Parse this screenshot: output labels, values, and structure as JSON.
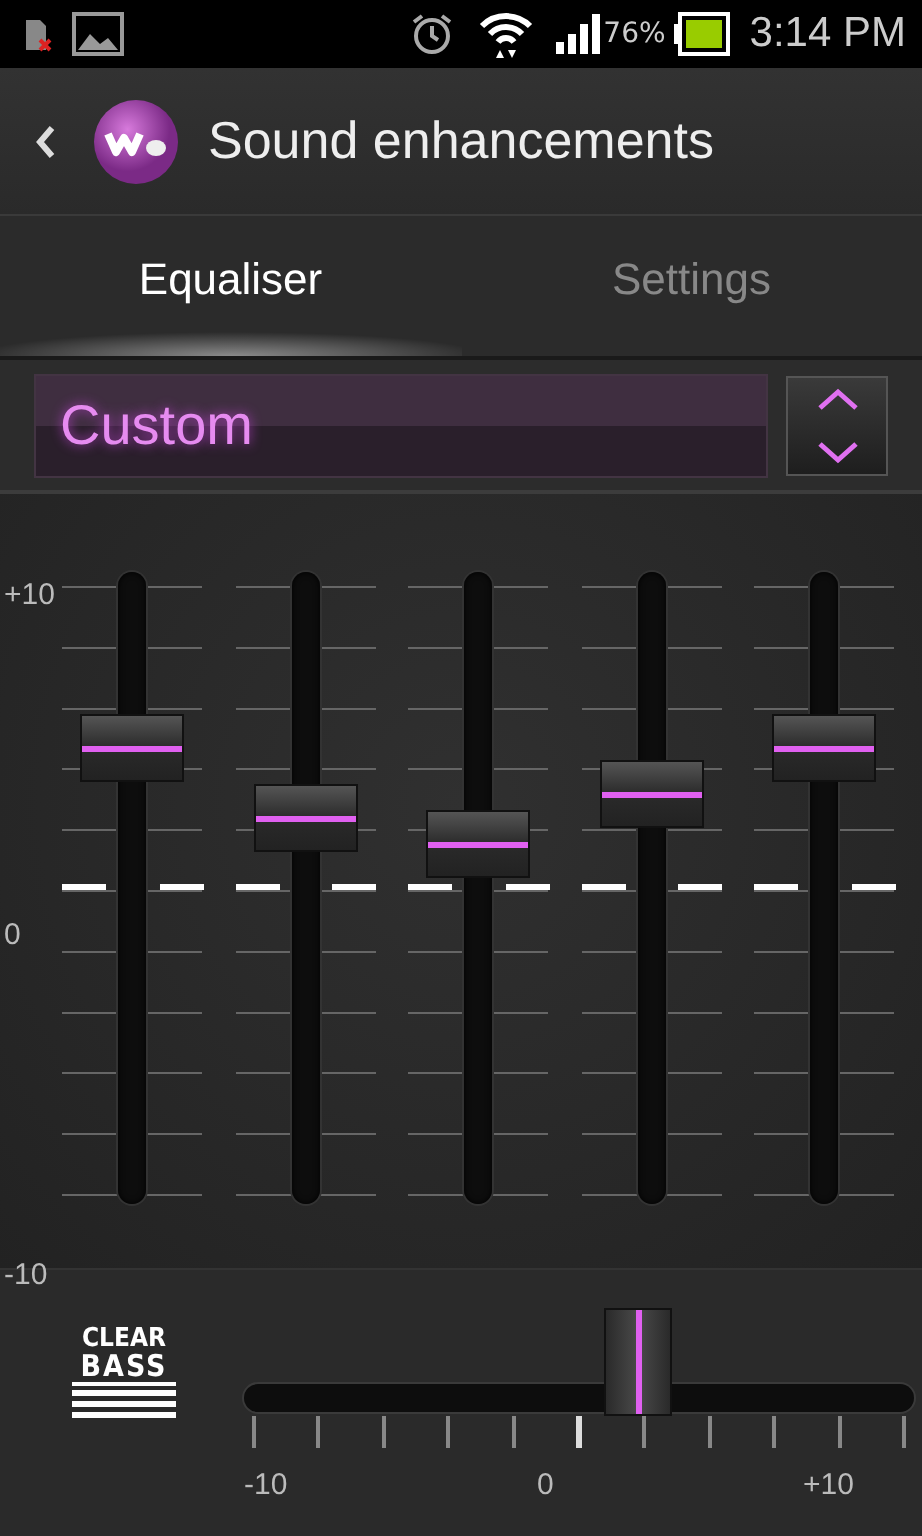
{
  "status_bar": {
    "battery": "76%",
    "time": "3:14 PM"
  },
  "header": {
    "title": "Sound enhancements"
  },
  "tabs": [
    {
      "label": "Equaliser",
      "selected": true
    },
    {
      "label": "Settings",
      "selected": false
    }
  ],
  "preset": {
    "value": "Custom"
  },
  "equaliser": {
    "scale": [
      "+10",
      "0",
      "-10"
    ],
    "bands": [
      {
        "level": 0.72
      },
      {
        "level": 0.61
      },
      {
        "level": 0.57
      },
      {
        "level": 0.65
      },
      {
        "level": 0.72
      }
    ]
  },
  "clear_bass": {
    "logo": [
      "CLEAR",
      "BASS"
    ],
    "level": 0.64,
    "ticks": [
      "-10",
      "0",
      "+10"
    ]
  }
}
